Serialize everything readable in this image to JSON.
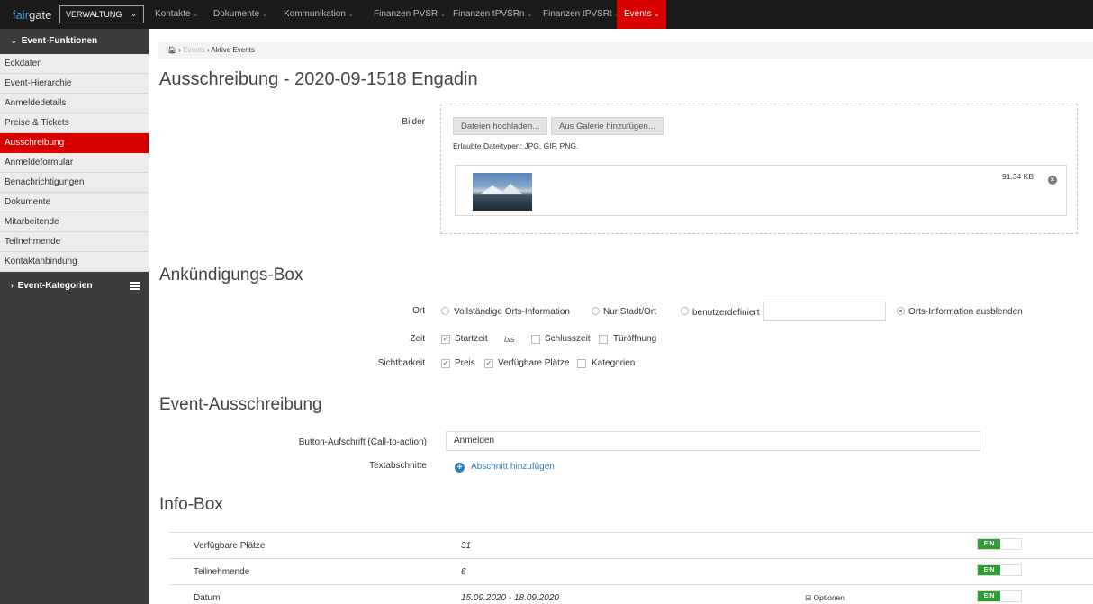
{
  "topbar": {
    "logo_fair": "fair",
    "logo_gate": "gate",
    "mode": "VERWALTUNG",
    "nav": [
      {
        "label": "Kontakte"
      },
      {
        "label": "Dokumente"
      },
      {
        "label": "Kommunikation"
      },
      {
        "label": "Finanzen PVSR"
      },
      {
        "label": "Finanzen tPVSRn"
      },
      {
        "label": "Finanzen tPVSRt"
      },
      {
        "label": "Events"
      }
    ]
  },
  "sidebar": {
    "group1": "Event-Funktionen",
    "items": [
      "Eckdaten",
      "Event-Hierarchie",
      "Anmeldedetails",
      "Preise & Tickets",
      "Ausschreibung",
      "Anmeldeformular",
      "Benachrichtigungen",
      "Dokumente",
      "Mitarbeitende",
      "Teilnehmende",
      "Kontaktanbindung"
    ],
    "active_index": 4,
    "group2": "Event-Kategorien"
  },
  "breadcrumb": {
    "part1": "Events",
    "part2": "Aktive Events"
  },
  "page_title": "Ausschreibung - 2020-09-1518 Engadin",
  "bilder": {
    "label": "Bilder",
    "upload_btn": "Dateien hochladen...",
    "gallery_btn": "Aus Galerie hinzufügen...",
    "allowed": "Erlaubte Dateitypen: JPG, GIF, PNG.",
    "file_size": "91.34 KB"
  },
  "ankuendigung": {
    "heading": "Ankündigungs-Box",
    "ort_label": "Ort",
    "ort_options": [
      "Vollständige Orts-Information",
      "Nur Stadt/Ort",
      "benutzerdefiniert",
      "Orts-Information ausblenden"
    ],
    "zeit_label": "Zeit",
    "startzeit": "Startzeit",
    "bis": "bis",
    "schlusszeit": "Schlusszeit",
    "tueroeffnung": "Türöffnung",
    "sicht_label": "Sichtbarkeit",
    "preis": "Preis",
    "plaetze": "Verfügbare Plätze",
    "kategorien": "Kategorien"
  },
  "event_ausschreibung": {
    "heading": "Event-Ausschreibung",
    "button_label": "Button-Aufschrift (Call-to-action)",
    "button_value": "Anmelden",
    "text_label": "Textabschnitte",
    "add_link": "Abschnitt hinzufügen"
  },
  "info_box": {
    "heading": "Info-Box",
    "rows": [
      {
        "label": "Verfügbare Plätze",
        "value": "31"
      },
      {
        "label": "Teilnehmende",
        "value": "6"
      },
      {
        "label": "Datum",
        "value": "15.09.2020 - 18.09.2020"
      }
    ],
    "optionen": "Optionen",
    "toggle_on": "EIN"
  }
}
